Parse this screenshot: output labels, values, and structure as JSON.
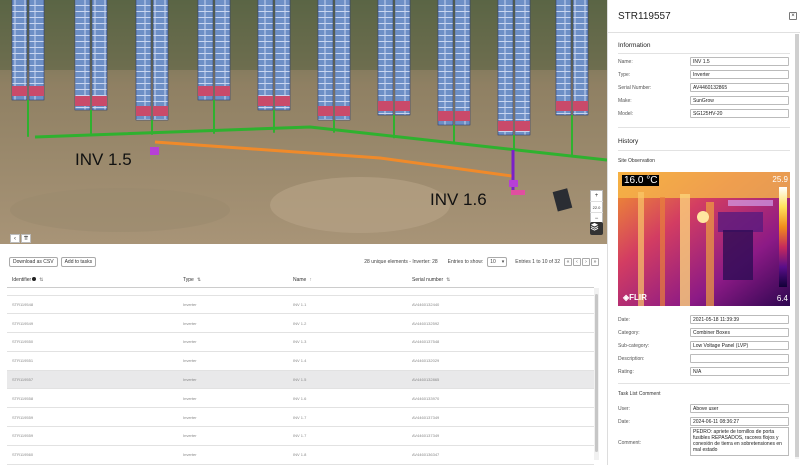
{
  "map": {
    "labels": [
      "INV 1.5",
      "INV 1.6"
    ],
    "zoom_level": "22.0",
    "controls": {
      "zoom_in": "+",
      "zoom_out": "−"
    },
    "nav": [
      "‹",
      "⇈"
    ],
    "colors": {
      "cable_green": "#2fb12f",
      "cable_orange": "#f08a2a",
      "inverter_magenta": "#b73fd6"
    }
  },
  "toolbar": {
    "download_label": "Download as CSV",
    "add_tasks_label": "Add to tasks",
    "summary": "28 unique elements - Inverter: 28",
    "entries_label": "Entries to show:",
    "entries_value": "10",
    "range_text": "Entries 1 to 10 of 32",
    "pager": [
      "«",
      "‹",
      "›",
      "»"
    ]
  },
  "table": {
    "columns": [
      {
        "label": "Identifier",
        "sort": "⇅"
      },
      {
        "label": "Type",
        "sort": "⇅"
      },
      {
        "label": "Name",
        "sort": "↑"
      },
      {
        "label": "Serial number",
        "sort": "⇅"
      }
    ],
    "rows": [
      [
        "STR119548",
        "Inverter",
        "INV 1.1",
        "AV4460132440"
      ],
      [
        "STR119549",
        "Inverter",
        "INV 1.2",
        "AV4460132592"
      ],
      [
        "STR119550",
        "Inverter",
        "INV 1.3",
        "AV4460137548"
      ],
      [
        "STR119551",
        "Inverter",
        "INV 1.4",
        "AV4460132029"
      ],
      [
        "STR119557",
        "Inverter",
        "INV 1.5",
        "AV4460132865"
      ],
      [
        "STR119558",
        "Inverter",
        "INV 1.6",
        "AV4460133970"
      ],
      [
        "STR119559",
        "Inverter",
        "INV 1.7",
        "AV4460137349"
      ],
      [
        "STR119559",
        "Inverter",
        "INV 1.7",
        "AV4460137349"
      ],
      [
        "STR119560",
        "Inverter",
        "INV 1.8",
        "AV4460136347"
      ],
      [
        "STR119560",
        "Inverter",
        "INV 1.8",
        "AV4460136347"
      ]
    ],
    "selected_row": 4
  },
  "panel": {
    "title": "STR119557",
    "close": "×",
    "information_title": "Information",
    "info": [
      {
        "label": "Name:",
        "value": "INV 1.5"
      },
      {
        "label": "Type:",
        "value": "Inverter"
      },
      {
        "label": "Serial Number:",
        "value": "AV4460132865"
      },
      {
        "label": "Make:",
        "value": "SunGrow"
      },
      {
        "label": "Model:",
        "value": "SG125HV-20"
      }
    ],
    "history_title": "History",
    "site_observation_title": "Site Observation",
    "thermal": {
      "main_temp": "16.0 °C",
      "max": "25.9",
      "min": "6.4",
      "brand": "◈FLIR"
    },
    "observation": [
      {
        "label": "Date:",
        "value": "2021-05-18 11:39:39"
      },
      {
        "label": "Category:",
        "value": "Combiner Boxes"
      },
      {
        "label": "Sub-category:",
        "value": "Low Voltage Panel (LVP)"
      },
      {
        "label": "Description:",
        "value": ""
      },
      {
        "label": "Rating:",
        "value": "N/A"
      }
    ],
    "task_comment_title": "Task List Comment",
    "task": [
      {
        "label": "User:",
        "value": "Above user"
      },
      {
        "label": "Date:",
        "value": "2024-06-11 08:36:27"
      }
    ],
    "comment_label": "Comment:",
    "comment_value": "PEDRO: apriete de tornillos de porta fusibles REPASADOS, racores flojos y conexión de tierra en sobretensiones en mal estado"
  }
}
